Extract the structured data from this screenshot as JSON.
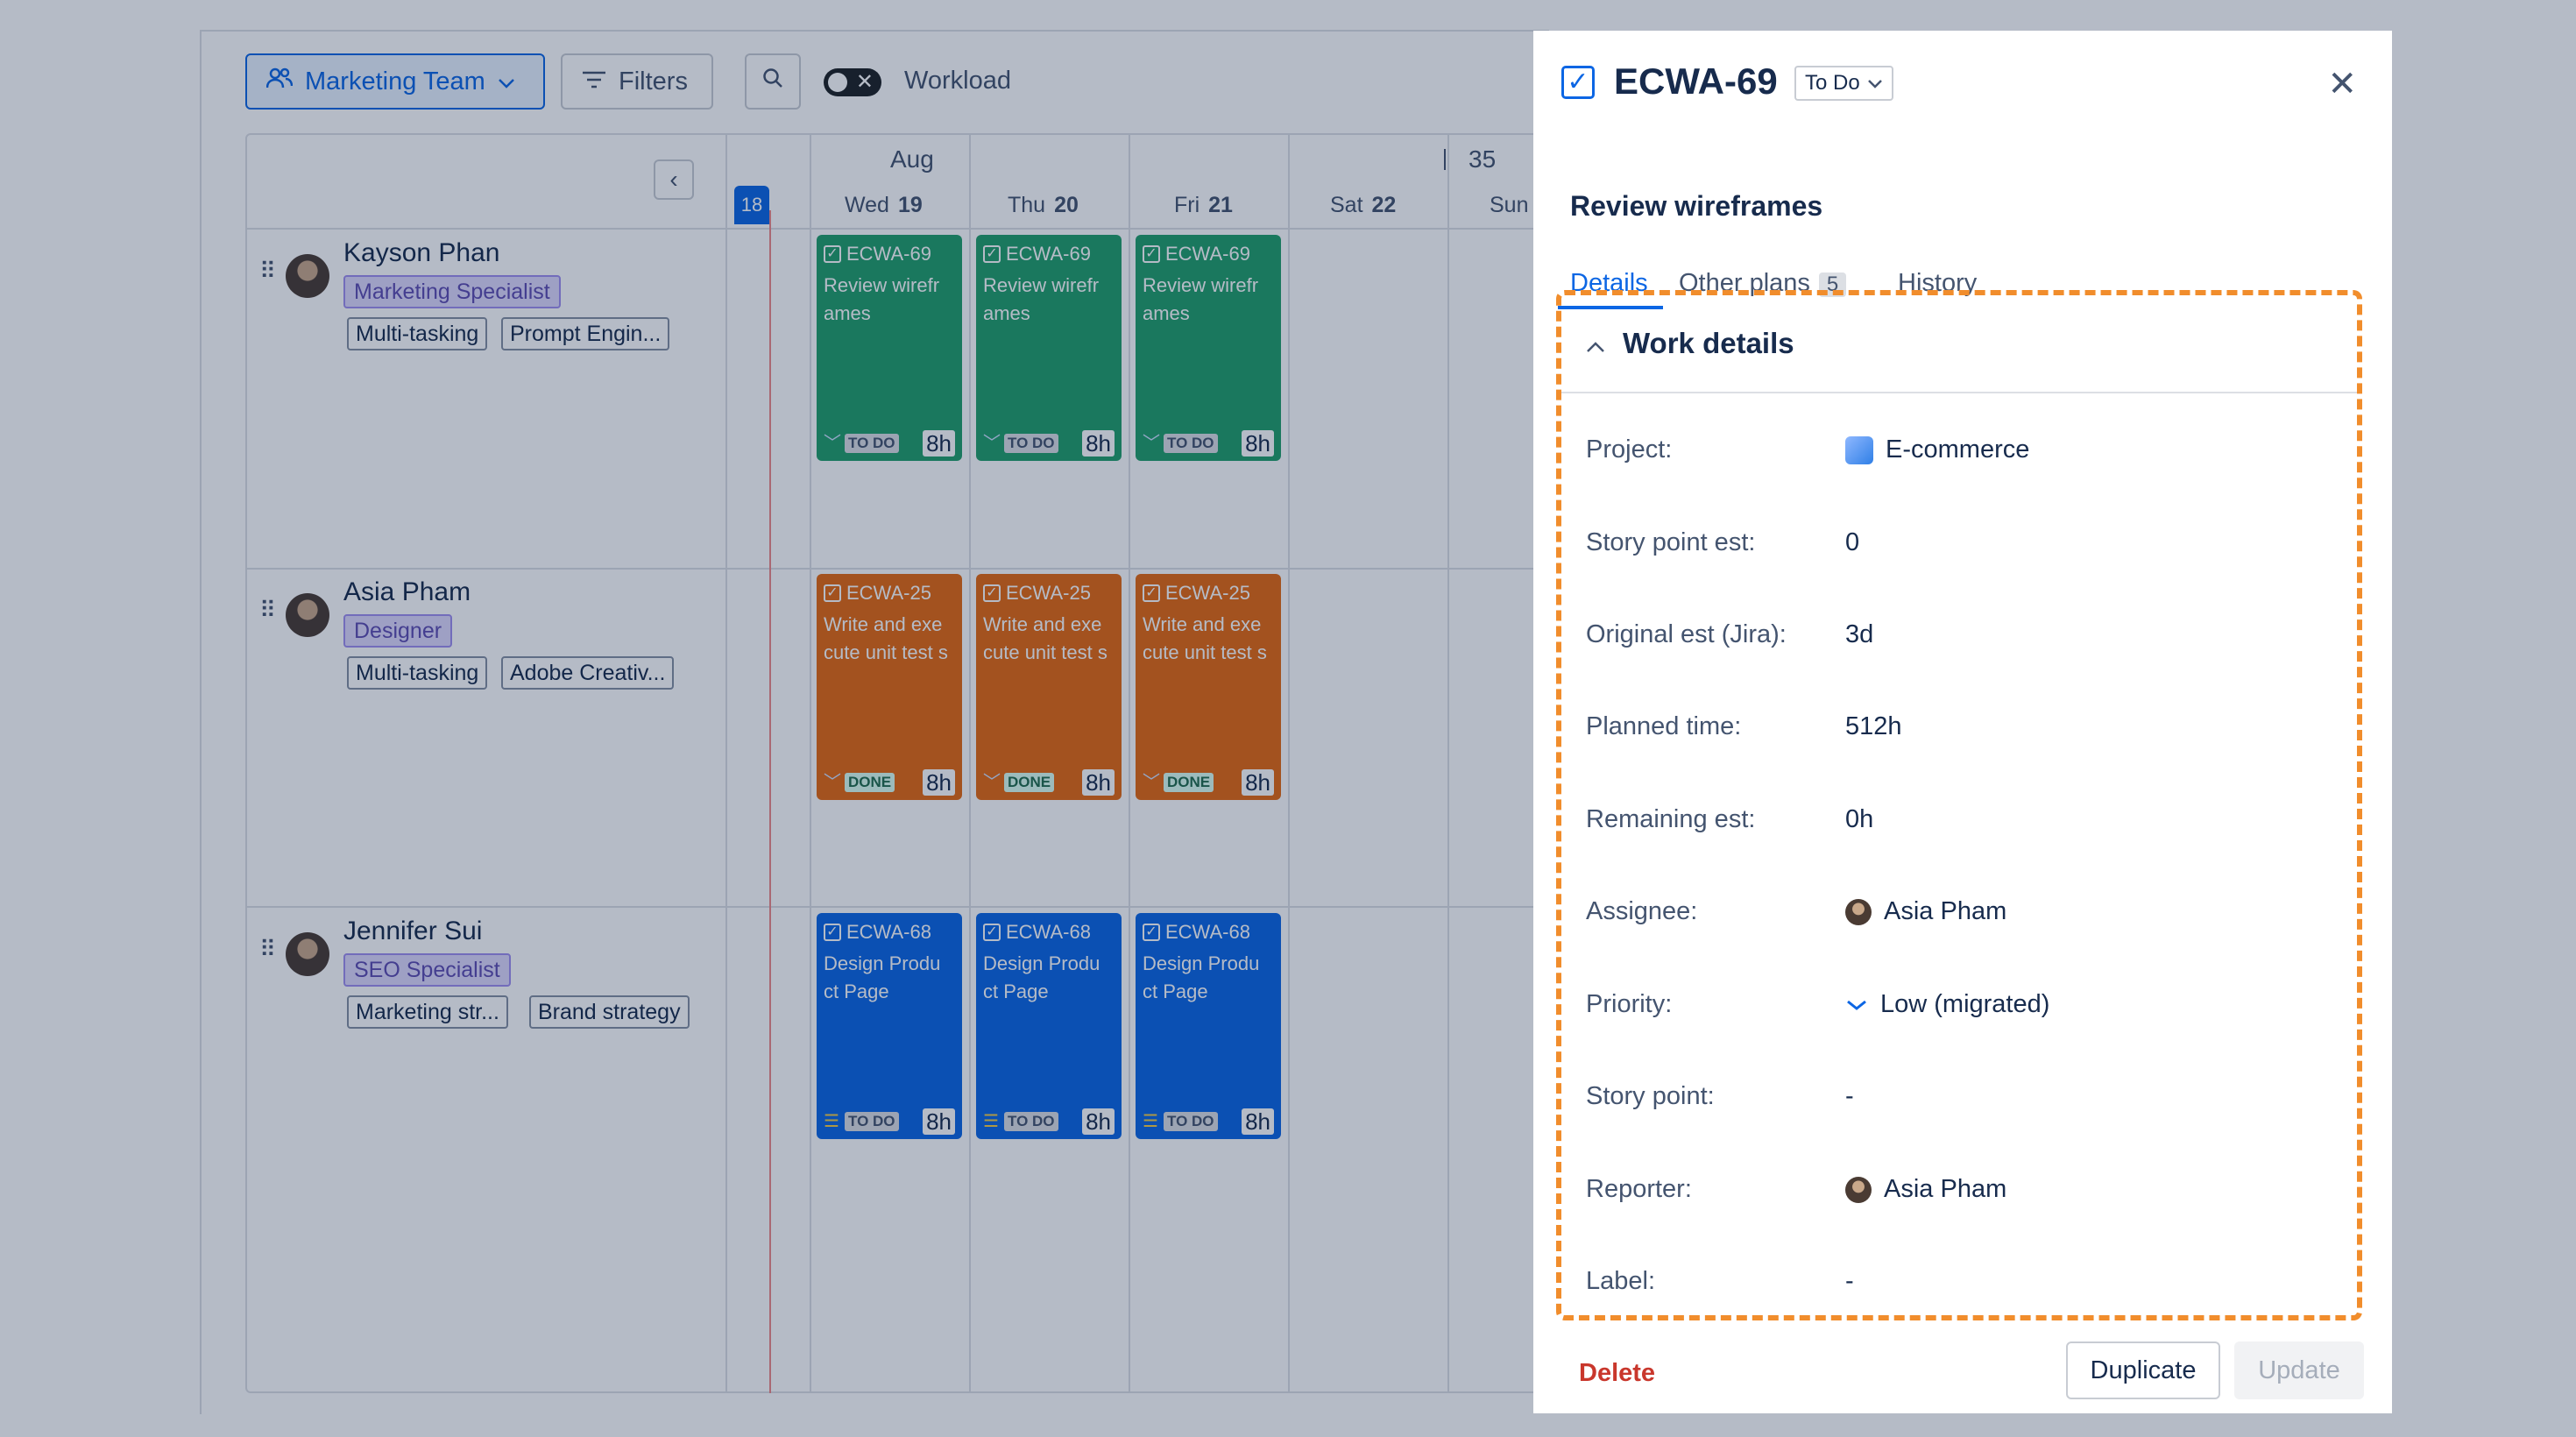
{
  "toolbar": {
    "team_label": "Marketing Team",
    "filters_label": "Filters",
    "workload_label": "Workload"
  },
  "calendar": {
    "month": "Aug",
    "week_number": "35",
    "today": "18",
    "days": [
      {
        "name": "Wed",
        "num": "19"
      },
      {
        "name": "Thu",
        "num": "20"
      },
      {
        "name": "Fri",
        "num": "21"
      },
      {
        "name": "Sat",
        "num": "22"
      },
      {
        "name": "Sun",
        "num": ""
      }
    ]
  },
  "people": [
    {
      "name": "Kayson Phan",
      "role": "Marketing Specialist",
      "skills": [
        "Multi-tasking",
        "Prompt Engin..."
      ],
      "task": {
        "key": "ECWA-69",
        "title": "Review wirefr ames",
        "status": "TO DO",
        "hours": "8h",
        "color": "#22a06b"
      }
    },
    {
      "name": "Asia Pham",
      "role": "Designer",
      "skills": [
        "Multi-tasking",
        "Adobe Creativ..."
      ],
      "task": {
        "key": "ECWA-25",
        "title": "Write and exe cute unit test s",
        "status": "DONE",
        "hours": "8h",
        "color": "#e56910"
      }
    },
    {
      "name": "Jennifer Sui",
      "role": "SEO Specialist",
      "skills": [
        "Marketing str...",
        "Brand strategy"
      ],
      "task": {
        "key": "ECWA-68",
        "title": "Design Produ ct Page",
        "status": "TO DO",
        "hours": "8h",
        "color": "#0c66e4"
      }
    }
  ],
  "panel": {
    "issue_key": "ECWA-69",
    "status": "To Do",
    "title": "Review wireframes",
    "tabs": [
      {
        "label": "Details"
      },
      {
        "label": "Other plans",
        "count": "5"
      },
      {
        "label": "History"
      }
    ],
    "section_title": "Work details",
    "fields": [
      {
        "label": "Project:",
        "value": "E-commerce",
        "icon": "project-icon"
      },
      {
        "label": "Story point est:",
        "value": "0"
      },
      {
        "label": "Original est (Jira):",
        "value": "3d"
      },
      {
        "label": "Planned time:",
        "value": "512h"
      },
      {
        "label": "Remaining est:",
        "value": "0h"
      },
      {
        "label": "Assignee:",
        "value": "Asia Pham",
        "icon": "avatar"
      },
      {
        "label": "Priority:",
        "value": "Low (migrated)",
        "icon": "chevron-low-icon"
      },
      {
        "label": "Story point:",
        "value": "-"
      },
      {
        "label": "Reporter:",
        "value": "Asia Pham",
        "icon": "avatar"
      },
      {
        "label": "Label:",
        "value": "-"
      }
    ],
    "delete_label": "Delete",
    "duplicate_label": "Duplicate",
    "update_label": "Update"
  },
  "colors": {
    "accent": "#0c66e4",
    "highlight_border": "#f18d2c",
    "danger": "#c9372c"
  }
}
